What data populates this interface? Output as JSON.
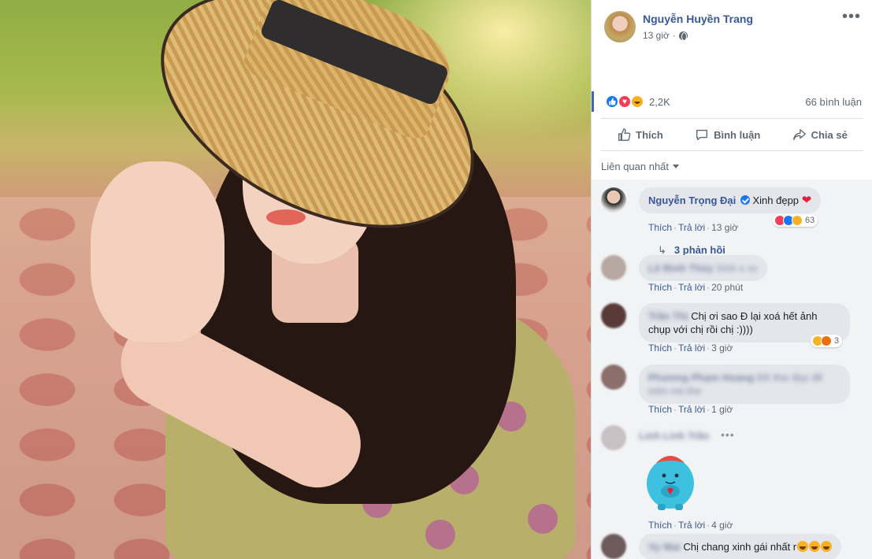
{
  "post": {
    "author_name": "Nguyễn Huyền Trang",
    "time": "13 giờ",
    "reaction_count": "2,2K",
    "comment_count": "66 bình luận"
  },
  "actions": {
    "like": "Thích",
    "comment": "Bình luận",
    "share": "Chia sẻ"
  },
  "sort_label": "Liên quan nhất",
  "comments": [
    {
      "name": "Nguyễn Trọng Đại",
      "text": "Xinh đẹpp",
      "like": "Thích",
      "reply": "Trả lời",
      "time": "13 giờ",
      "reaction_count": "63",
      "replies": "3 phản hồi"
    },
    {
      "name": "Lê Bình Thùy",
      "text": "Xinh x xx",
      "like": "Thích",
      "reply": "Trả lời",
      "time": "20 phút"
    },
    {
      "name": "Trần Thị",
      "text": "Chị ơi sao Đ lại xoá hết ảnh chụp với chị rồi chị :))))",
      "like": "Thích",
      "reply": "Trả lời",
      "time": "3 giờ",
      "reaction_count": "3"
    },
    {
      "name": "Phương Phạm Hoang",
      "text": "Đề thw đẹp đề mlm nói the",
      "like": "Thích",
      "reply": "Trả lời",
      "time": "1 giờ"
    },
    {
      "name": "Linh Linh Trần",
      "like": "Thích",
      "reply": "Trả lời",
      "time": "4 giờ"
    },
    {
      "name": "Vy Mai",
      "text": "Chị chang xinh gái nhất r"
    }
  ],
  "colors": {
    "link_blue": "#385898",
    "like_blue": "#1877f2",
    "love_red": "#f33e58",
    "haha_yellow": "#f7b125"
  }
}
